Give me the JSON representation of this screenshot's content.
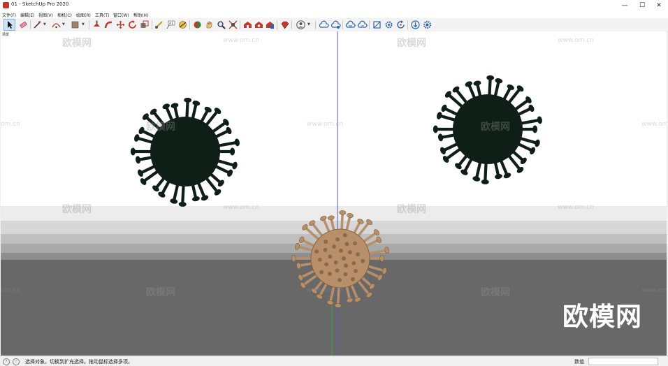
{
  "window": {
    "title": "01 - SketchUp Pro 2020",
    "controls": {
      "minimize": "—",
      "maximize": "☐",
      "close": "✕"
    }
  },
  "menu": [
    "文件(F)",
    "编辑(E)",
    "视图(V)",
    "相机(C)",
    "绘图(R)",
    "工具(T)",
    "窗口(W)",
    "帮助(H)"
  ],
  "toolbar": {
    "icons": [
      "select-arrow-icon",
      "eraser-icon",
      "pencil-line-icon",
      "arc-icon",
      "paint-bucket-icon",
      "push-pull-icon",
      "follow-me-icon",
      "move-icon",
      "rotate-icon",
      "scale-icon",
      "tape-measure-icon",
      "text-icon",
      "protractor-icon",
      "orbit-icon",
      "pan-icon",
      "zoom-icon",
      "zoom-extents-icon",
      "warehouse-icon",
      "extension-warehouse-icon",
      "layout-icon",
      "ruby-icon",
      "profile-icon",
      "cloud-icon",
      "cloud-upload-icon",
      "cloud-sync-icon",
      "section-icon",
      "settings-icon",
      "refresh-icon",
      "download-icon",
      "gear-icon"
    ]
  },
  "viewport": {
    "scene_tab": "场景",
    "colors": {
      "sky": "#ffffff",
      "ground": "#686868",
      "virus_dark": "#0f1f17",
      "virus_light": "#b7906b",
      "axis_blue": "#5a5ab8",
      "axis_green": "#2fa84f"
    },
    "watermark_cn": "欧模网",
    "watermark_url": "www.om.cn",
    "watermark_url_partial": "om.cn",
    "brand_logo": "欧模网"
  },
  "status": {
    "message": "选择对象。切换到扩充选择。拖动鼠标选择多项。",
    "measurements_label": "数值",
    "measurements_value": ""
  }
}
